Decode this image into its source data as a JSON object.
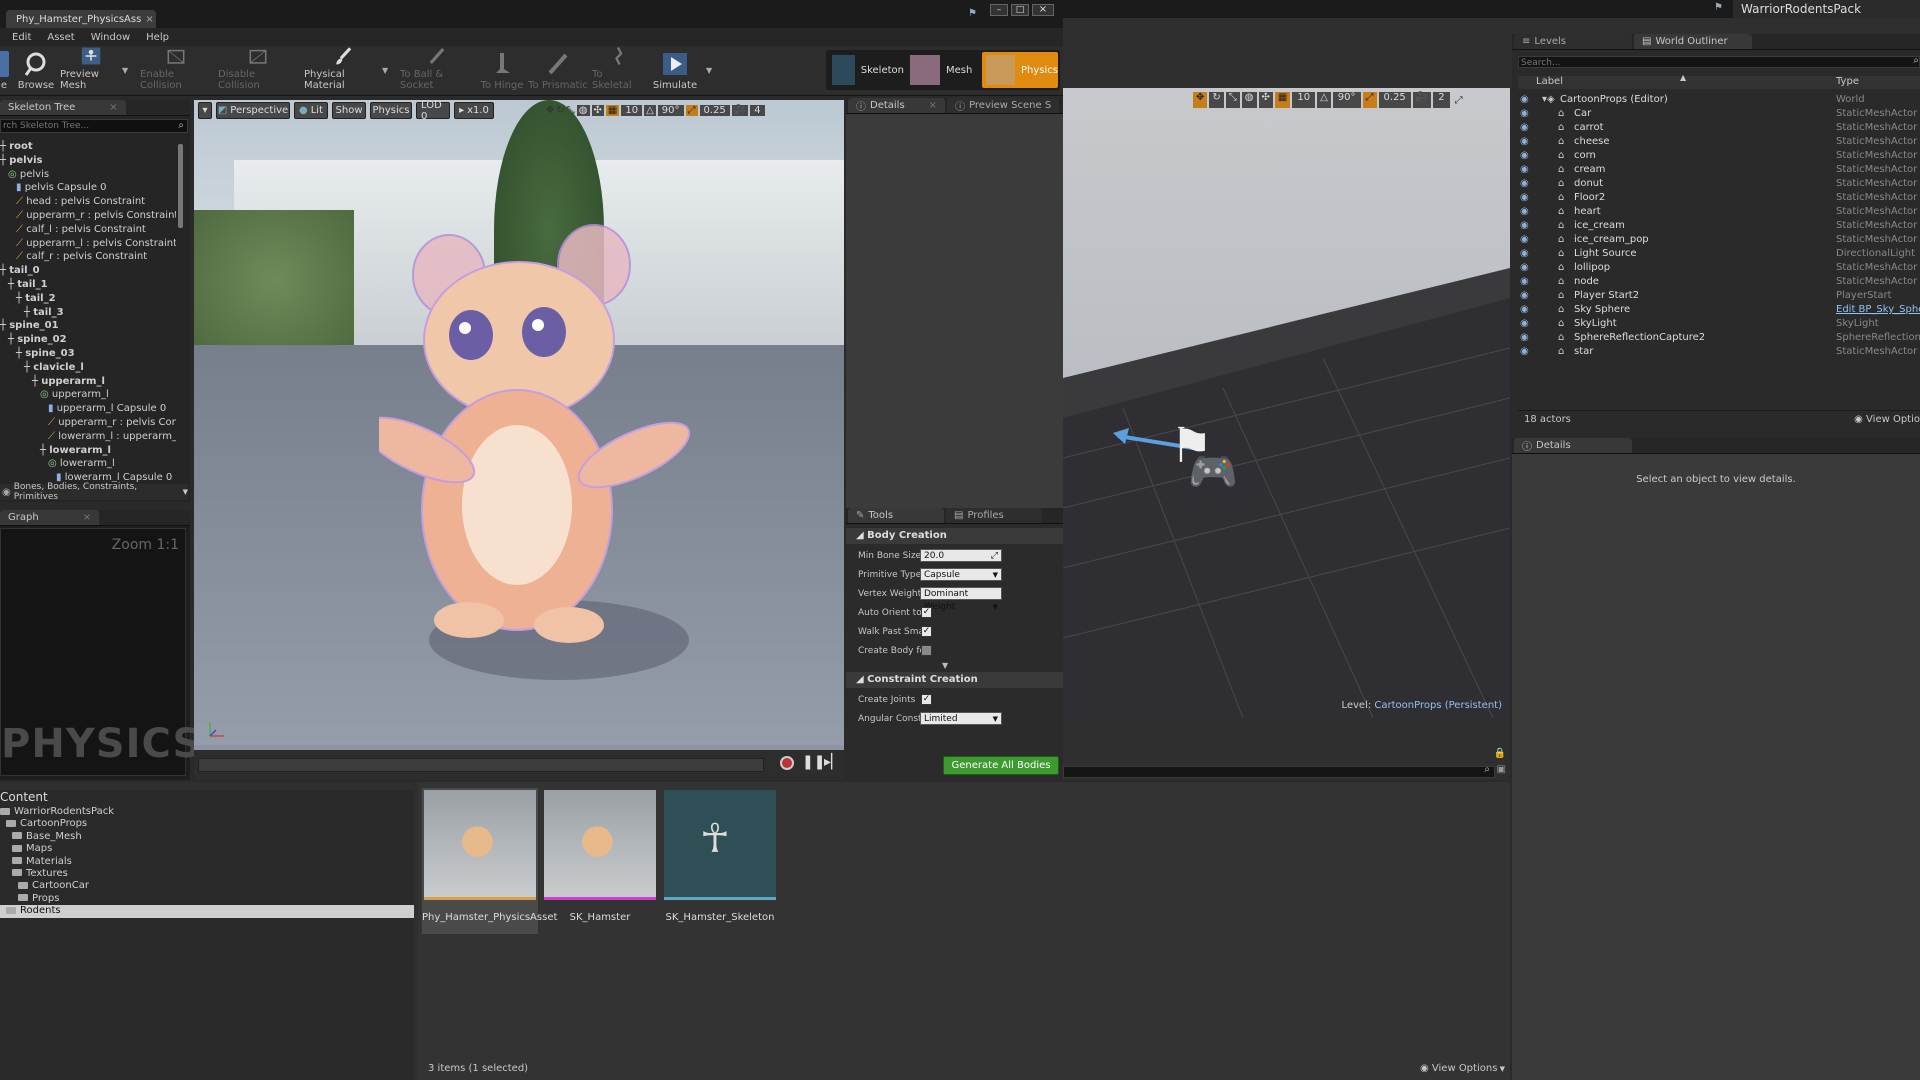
{
  "window": {
    "tab_title": "Phy_Hamster_PhysicsAss",
    "right_title": "WarriorRodentsPack"
  },
  "menu": [
    "Edit",
    "Asset",
    "Window",
    "Help"
  ],
  "toolbar": {
    "items": [
      {
        "label": "e",
        "enabled": true
      },
      {
        "label": "Browse",
        "enabled": true
      },
      {
        "label": "Preview Mesh",
        "enabled": true
      },
      {
        "label": "Enable Collision",
        "enabled": false
      },
      {
        "label": "Disable Collision",
        "enabled": false
      },
      {
        "label": "Physical Material",
        "enabled": true
      },
      {
        "label": "To Ball & Socket",
        "enabled": false
      },
      {
        "label": "To Hinge",
        "enabled": false
      },
      {
        "label": "To Prismatic",
        "enabled": false
      },
      {
        "label": "To Skeletal",
        "enabled": false
      },
      {
        "label": "Simulate",
        "enabled": true
      }
    ],
    "modes": [
      "Skeleton",
      "Mesh",
      "Physics"
    ]
  },
  "skeleton_tree": {
    "tab": "Skeleton Tree",
    "search_placeholder": "rch Skeleton Tree...",
    "rows": [
      {
        "text": "root",
        "indent": 0,
        "bold": true
      },
      {
        "text": "pelvis",
        "indent": 0,
        "bold": true
      },
      {
        "text": "pelvis",
        "indent": 1,
        "bold": false
      },
      {
        "text": "pelvis Capsule 0",
        "indent": 2,
        "bold": false
      },
      {
        "text": "head : pelvis Constraint",
        "indent": 2,
        "bold": false
      },
      {
        "text": "upperarm_r : pelvis Constraint",
        "indent": 2,
        "bold": false
      },
      {
        "text": "calf_l : pelvis Constraint",
        "indent": 2,
        "bold": false
      },
      {
        "text": "upperarm_l : pelvis Constraint",
        "indent": 2,
        "bold": false
      },
      {
        "text": "calf_r : pelvis Constraint",
        "indent": 2,
        "bold": false
      },
      {
        "text": "tail_0",
        "indent": 0,
        "bold": true
      },
      {
        "text": "tail_1",
        "indent": 1,
        "bold": true
      },
      {
        "text": "tail_2",
        "indent": 2,
        "bold": true
      },
      {
        "text": "tail_3",
        "indent": 3,
        "bold": true
      },
      {
        "text": "spine_01",
        "indent": 0,
        "bold": true
      },
      {
        "text": "spine_02",
        "indent": 1,
        "bold": true
      },
      {
        "text": "spine_03",
        "indent": 2,
        "bold": true
      },
      {
        "text": "clavicle_l",
        "indent": 3,
        "bold": true
      },
      {
        "text": "upperarm_l",
        "indent": 4,
        "bold": true
      },
      {
        "text": "upperarm_l",
        "indent": 5,
        "bold": false
      },
      {
        "text": "upperarm_l Capsule 0",
        "indent": 6,
        "bold": false
      },
      {
        "text": "upperarm_r : pelvis Cons",
        "indent": 6,
        "bold": false
      },
      {
        "text": "lowerarm_l : upperarm_l",
        "indent": 6,
        "bold": false
      },
      {
        "text": "lowerarm_l",
        "indent": 5,
        "bold": true
      },
      {
        "text": "lowerarm_l",
        "indent": 6,
        "bold": false
      },
      {
        "text": "lowerarm_l Capsule 0",
        "indent": 7,
        "bold": false
      }
    ],
    "filter_label": "Bones, Bodies, Constraints, Primitives"
  },
  "graph": {
    "tab": "Graph",
    "zoom": "Zoom 1:1",
    "watermark": "PHYSICS"
  },
  "viewport": {
    "buttons": [
      "Perspective",
      "Lit",
      "Show",
      "Physics",
      "LOD 0",
      "x1.0"
    ],
    "grid": "10",
    "angle": "90°",
    "scale": "0.25",
    "camera_speed": "4"
  },
  "details_tabs": [
    "Details",
    "Preview Scene S"
  ],
  "tools": {
    "tabs": [
      "Tools",
      "Profiles"
    ],
    "body_creation": "Body Creation",
    "min_bone_size_label": "Min Bone Size",
    "min_bone_size": "20.0",
    "primitive_type_label": "Primitive Type",
    "primitive_type": "Capsule",
    "vertex_weight_label": "Vertex Weight",
    "vertex_weight": "Dominant Weight",
    "auto_orient_label": "Auto Orient to",
    "walk_past_label": "Walk Past Sma",
    "create_body_label": "Create Body fo",
    "constraint_creation": "Constraint Creation",
    "create_joints_label": "Create Joints",
    "angular_label": "Angular Constr",
    "angular": "Limited",
    "generate_button": "Generate All Bodies"
  },
  "level_viewport": {
    "grid": "10",
    "angle": "90°",
    "scale": "0.25",
    "camera_speed": "2",
    "level_label": "Level:",
    "level_name": "CartoonProps (Persistent)"
  },
  "outliner": {
    "tabs": [
      "Levels",
      "World Outliner"
    ],
    "search_placeholder": "Search...",
    "col_label": "Label",
    "col_type": "Type",
    "rows": [
      {
        "label": "CartoonProps (Editor)",
        "type": "World",
        "indent": 0,
        "link": false
      },
      {
        "label": "Car",
        "type": "StaticMeshActor",
        "indent": 1,
        "link": false
      },
      {
        "label": "carrot",
        "type": "StaticMeshActor",
        "indent": 1,
        "link": false
      },
      {
        "label": "cheese",
        "type": "StaticMeshActor",
        "indent": 1,
        "link": false
      },
      {
        "label": "corn",
        "type": "StaticMeshActor",
        "indent": 1,
        "link": false
      },
      {
        "label": "cream",
        "type": "StaticMeshActor",
        "indent": 1,
        "link": false
      },
      {
        "label": "donut",
        "type": "StaticMeshActor",
        "indent": 1,
        "link": false
      },
      {
        "label": "Floor2",
        "type": "StaticMeshActor",
        "indent": 1,
        "link": false
      },
      {
        "label": "heart",
        "type": "StaticMeshActor",
        "indent": 1,
        "link": false
      },
      {
        "label": "ice_cream",
        "type": "StaticMeshActor",
        "indent": 1,
        "link": false
      },
      {
        "label": "ice_cream_pop",
        "type": "StaticMeshActor",
        "indent": 1,
        "link": false
      },
      {
        "label": "Light Source",
        "type": "DirectionalLight",
        "indent": 1,
        "link": false
      },
      {
        "label": "lollipop",
        "type": "StaticMeshActor",
        "indent": 1,
        "link": false
      },
      {
        "label": "node",
        "type": "StaticMeshActor",
        "indent": 1,
        "link": false
      },
      {
        "label": "Player Start2",
        "type": "PlayerStart",
        "indent": 1,
        "link": false
      },
      {
        "label": "Sky Sphere",
        "type": "Edit BP_Sky_Sphere",
        "indent": 1,
        "link": true
      },
      {
        "label": "SkyLight",
        "type": "SkyLight",
        "indent": 1,
        "link": false
      },
      {
        "label": "SphereReflectionCapture2",
        "type": "SphereReflectionCapt",
        "indent": 1,
        "link": false
      },
      {
        "label": "star",
        "type": "StaticMeshActor",
        "indent": 1,
        "link": false
      }
    ],
    "actor_count": "18 actors",
    "view_options": "View Optio"
  },
  "details_panel": {
    "tab": "Details",
    "empty_text": "Select an object to view details."
  },
  "content": {
    "root_label": "Content",
    "tree": [
      {
        "label": "WarriorRodentsPack",
        "indent": 0,
        "selected": false
      },
      {
        "label": "CartoonProps",
        "indent": 1,
        "selected": false
      },
      {
        "label": "Base_Mesh",
        "indent": 2,
        "selected": false
      },
      {
        "label": "Maps",
        "indent": 2,
        "selected": false
      },
      {
        "label": "Materials",
        "indent": 2,
        "selected": false
      },
      {
        "label": "Textures",
        "indent": 2,
        "selected": false
      },
      {
        "label": "CartoonCar",
        "indent": 3,
        "selected": false
      },
      {
        "label": "Props",
        "indent": 3,
        "selected": false
      },
      {
        "label": "Rodents",
        "indent": 1,
        "selected": true
      }
    ],
    "assets": [
      {
        "name": "Phy_Hamster_PhysicsAsset",
        "accent": "#d9a04a",
        "selected": true
      },
      {
        "name": "SK_Hamster",
        "accent": "#d23dd2",
        "selected": false
      },
      {
        "name": "SK_Hamster_Skeleton",
        "accent": "#5fa8c8",
        "selected": false
      }
    ],
    "status": "3 items (1 selected)",
    "view_options": "View Options"
  }
}
